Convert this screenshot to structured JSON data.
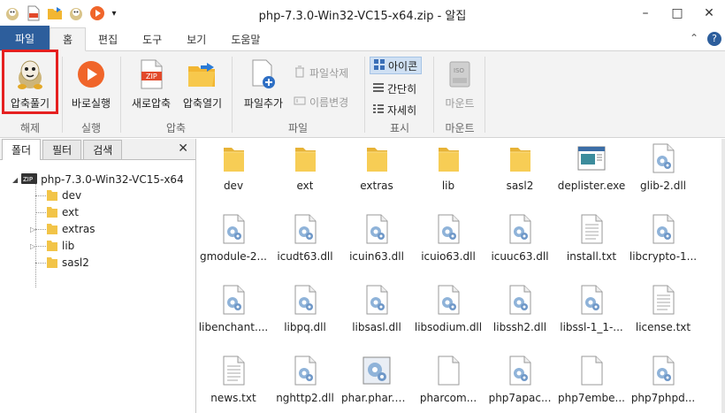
{
  "window": {
    "title": "php-7.3.0-Win32-VC15-x64.zip - 알집",
    "controls": [
      "–",
      "□",
      "✕"
    ]
  },
  "ribbon_tabs": [
    "파일",
    "홈",
    "편집",
    "도구",
    "보기",
    "도움말"
  ],
  "ribbon": {
    "extract": {
      "button": "압축풀기",
      "group": "해제"
    },
    "run": {
      "button": "바로실행",
      "group": "실행"
    },
    "compress": {
      "new": "새로압축",
      "open": "압축열기",
      "group": "압축"
    },
    "file": {
      "add": "파일추가",
      "delete": "파일삭제",
      "rename": "이름변경",
      "group": "파일"
    },
    "view": {
      "icons": "아이콘",
      "list": "간단히",
      "details": "자세히",
      "group": "표시"
    },
    "mount": {
      "button": "마운트",
      "group": "마운트"
    }
  },
  "left_pane": {
    "tabs": [
      "폴더",
      "필터",
      "검색"
    ],
    "close": "✕",
    "root": "php-7.3.0-Win32-VC15-x64",
    "children": [
      "dev",
      "ext",
      "extras",
      "lib",
      "sasl2"
    ]
  },
  "files": [
    {
      "name": "dev",
      "type": "folder"
    },
    {
      "name": "ext",
      "type": "folder"
    },
    {
      "name": "extras",
      "type": "folder"
    },
    {
      "name": "lib",
      "type": "folder"
    },
    {
      "name": "sasl2",
      "type": "folder"
    },
    {
      "name": "deplister.exe",
      "type": "exe"
    },
    {
      "name": "glib-2.dll",
      "type": "dll"
    },
    {
      "name": "gmodule-2...",
      "type": "dll"
    },
    {
      "name": "icudt63.dll",
      "type": "dll"
    },
    {
      "name": "icuin63.dll",
      "type": "dll"
    },
    {
      "name": "icuio63.dll",
      "type": "dll"
    },
    {
      "name": "icuuc63.dll",
      "type": "dll"
    },
    {
      "name": "install.txt",
      "type": "txt"
    },
    {
      "name": "libcrypto-1...",
      "type": "dll"
    },
    {
      "name": "libenchant....",
      "type": "dll"
    },
    {
      "name": "libpq.dll",
      "type": "dll"
    },
    {
      "name": "libsasl.dll",
      "type": "dll"
    },
    {
      "name": "libsodium.dll",
      "type": "dll"
    },
    {
      "name": "libssh2.dll",
      "type": "dll"
    },
    {
      "name": "libssl-1_1-...",
      "type": "dll"
    },
    {
      "name": "license.txt",
      "type": "txt"
    },
    {
      "name": "news.txt",
      "type": "txt"
    },
    {
      "name": "nghttp2.dll",
      "type": "dll"
    },
    {
      "name": "phar.phar.bat",
      "type": "bat"
    },
    {
      "name": "pharcom...",
      "type": "blank"
    },
    {
      "name": "php7apac...",
      "type": "dll"
    },
    {
      "name": "php7embe...",
      "type": "blank"
    },
    {
      "name": "php7phpd...",
      "type": "dll"
    }
  ],
  "colors": {
    "file_tab": "#2d5e9c",
    "highlight": "#e52020",
    "folder": "#f2c448",
    "run": "#f0652a"
  }
}
